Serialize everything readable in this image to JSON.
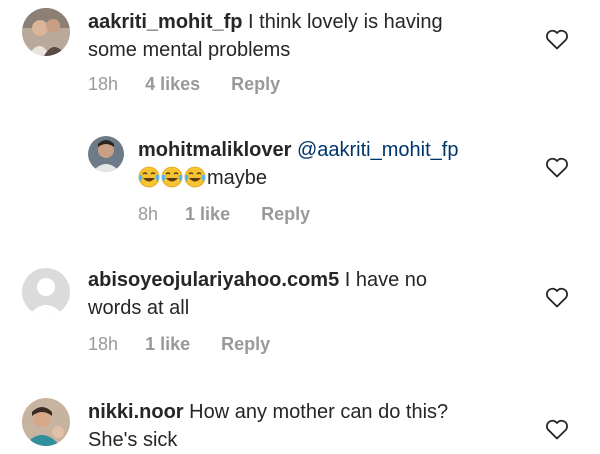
{
  "comments": [
    {
      "username": "aakriti_mohit_fp",
      "text_line1": "I think lovely is having",
      "text_line2": "some mental problems",
      "time": "18h",
      "likes": "4 likes",
      "reply": "Reply"
    },
    {
      "username": "mohitmaliklover",
      "mention": "@aakriti_mohit_fp",
      "emojis": [
        "face-with-tears-of-joy",
        "face-with-tears-of-joy",
        "face-with-tears-of-joy"
      ],
      "text": "maybe",
      "time": "8h",
      "likes": "1 like",
      "reply": "Reply"
    },
    {
      "username": "abisoyeojulariyahoo.com5",
      "text_line1": "I have no",
      "text_line2": "words at all",
      "time": "18h",
      "likes": "1 like",
      "reply": "Reply"
    },
    {
      "username": "nikki.noor",
      "text_line1": "How any mother can do this?",
      "text_line2": "She's sick"
    }
  ],
  "icons": {
    "like": "heart-outline-icon",
    "avatar_placeholder": "default-avatar-icon"
  },
  "colors": {
    "text": "#262626",
    "secondary": "#999999",
    "mention": "#003569",
    "avatar_placeholder": "#dbdbdb"
  }
}
